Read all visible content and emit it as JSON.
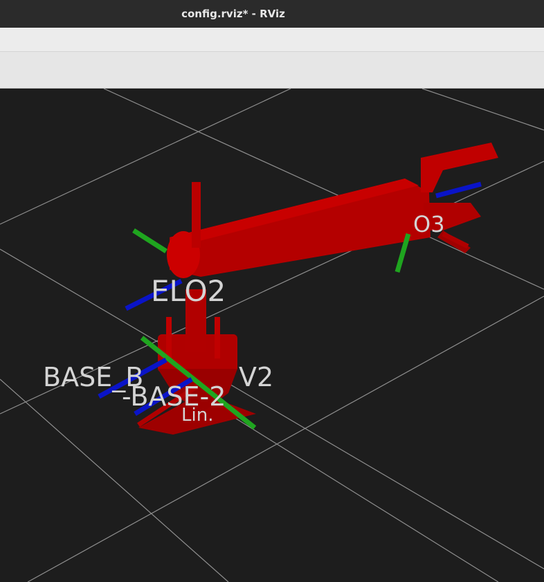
{
  "window": {
    "title": "config.rviz* - RViz"
  },
  "viewport": {
    "background": "#1d1d1d",
    "grid_color": "#9a9a9a",
    "robot_color": "#b00000",
    "axis_colors": {
      "x": "#b00000",
      "y": "#1fa51f",
      "z": "#0a14c8"
    },
    "frame_labels": {
      "elbow": "ELO2",
      "wrist": "O3",
      "base_link": "BASE_B",
      "base_v2": "V2",
      "base_dup": "-BASE-2",
      "base_dup_tail": "Lin."
    }
  }
}
